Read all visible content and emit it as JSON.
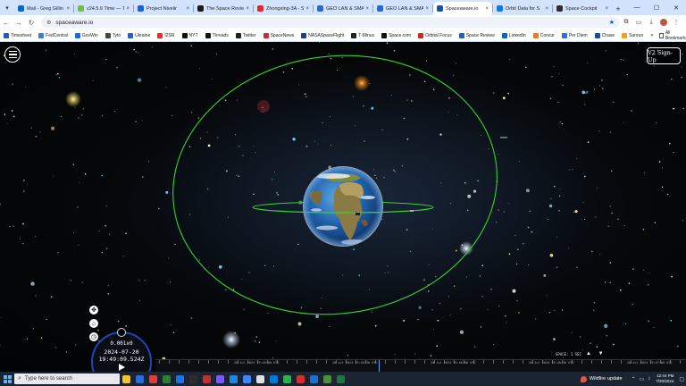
{
  "browser": {
    "tabs": [
      {
        "title": "Mail - Greg Gillin",
        "fav": "#0a66c2",
        "active": false
      },
      {
        "title": "v24.5.6 Time — T",
        "fav": "#6cc04a",
        "active": false
      },
      {
        "title": "Project Nivelir",
        "fav": "#1e5fd0",
        "active": false
      },
      {
        "title": "The Space Review",
        "fav": "#1b1b1b",
        "active": false
      },
      {
        "title": "Zhongxing-3A - S",
        "fav": "#d03030",
        "active": false
      },
      {
        "title": "GEO LAN & SMA",
        "fav": "#2a6acb",
        "active": false
      },
      {
        "title": "GEO LAN & SMA",
        "fav": "#2a6acb",
        "active": false
      },
      {
        "title": "Spaceaware.io",
        "fav": "#1b4fa8",
        "active": true
      },
      {
        "title": "Orbit Data for S",
        "fav": "#1a73e8",
        "active": false
      },
      {
        "title": "Space Cockpit",
        "fav": "#2e2e2e",
        "active": false
      }
    ],
    "new_tab": "+",
    "window_controls": [
      "—",
      "☐",
      "✕"
    ],
    "url": "spaceaware.io",
    "bookmarks": [
      {
        "label": "Timesheet",
        "color": "#2757b8"
      },
      {
        "label": "FedCentral",
        "color": "#3b7ed6"
      },
      {
        "label": "GovWin",
        "color": "#1d6bd6"
      },
      {
        "label": "Tyto",
        "color": "#444"
      },
      {
        "label": "Ukraine",
        "color": "#2a5cc8"
      },
      {
        "label": "I2SR",
        "color": "#e0312d"
      },
      {
        "label": "NYT",
        "color": "#111"
      },
      {
        "label": "Threads",
        "color": "#111"
      },
      {
        "label": "Twitter",
        "color": "#222"
      },
      {
        "label": "SpaceNews",
        "color": "#c42f2f"
      },
      {
        "label": "NASASpaceFlight",
        "color": "#1c3f8c"
      },
      {
        "label": "T-Minus",
        "color": "#222"
      },
      {
        "label": "Space.com",
        "color": "#111"
      },
      {
        "label": "Orbital Focus",
        "color": "#c52c2c"
      },
      {
        "label": "Space Review",
        "color": "#2860b8"
      },
      {
        "label": "LinkedIn",
        "color": "#0a66c2"
      },
      {
        "label": "Concur",
        "color": "#e57d1e"
      },
      {
        "label": "Per Diem",
        "color": "#3b6bd6"
      },
      {
        "label": "Chase",
        "color": "#1a4fa0"
      },
      {
        "label": "Sunrun",
        "color": "#f0a020"
      }
    ],
    "bookmarks_more": "»",
    "all_bookmarks": "All Bookmarks"
  },
  "app": {
    "signup_label": "V2 Sign-Up",
    "clock": {
      "speed": "0.001x0",
      "date": "2024-07-20",
      "time": "19:49:09.524Z"
    },
    "timeline": {
      "speed_label": "SPACE: 1 SEC",
      "labels": [
        "20 Jul 2024 19:45:00 UTC",
        "20 Jul 2024 19:45:30 UTC",
        "20 Jul 2024 19:46:00 UTC",
        "20 Jul 2024 19:46:30 UTC",
        "20 Jul 2024 19:47:00 UTC"
      ],
      "controls": "▲ ▼"
    },
    "colors": {
      "orbit_green": "#35d42f",
      "clock_ring": "#1a48b8"
    }
  },
  "taskbar": {
    "search_placeholder": "Type here to search",
    "apps": [
      "#f5c42c",
      "#2b6cd4",
      "#e13b3b",
      "#2e7d32",
      "#1a73e8",
      "#2c2c2c",
      "#c03030",
      "#7a5af8",
      "#1e88e5",
      "#4285f4",
      "#e0e0e0",
      "#0078d4",
      "#2bb24c",
      "#d03030",
      "#1d6fd0",
      "#4a8f3a",
      "#217346"
    ],
    "news": "Wildfire update",
    "time": "12:44 PM",
    "date": "7/20/2024"
  }
}
